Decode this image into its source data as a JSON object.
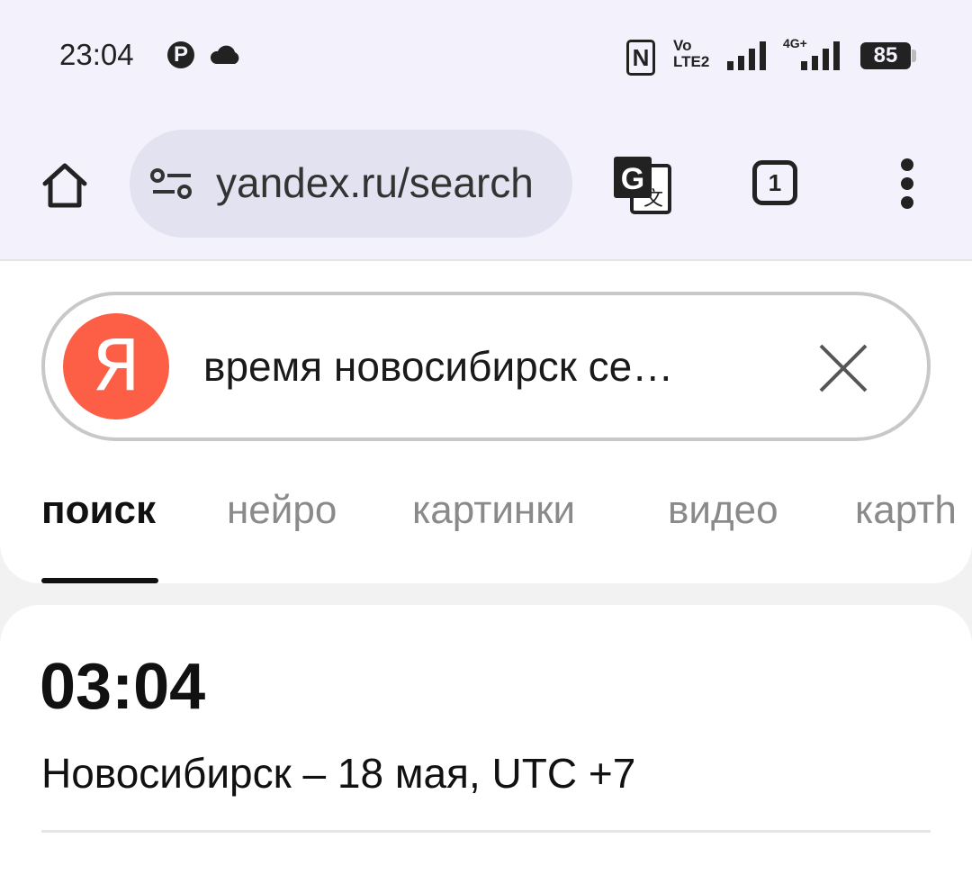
{
  "status_bar": {
    "time": "23:04",
    "pinterest_glyph": "P",
    "volte_top": "Vo",
    "volte_bottom": "LTE2",
    "network": "4G+",
    "battery": "85"
  },
  "browser": {
    "url": "yandex.ru/search",
    "tab_count": "1",
    "icons": [
      "home-icon",
      "site-settings-icon",
      "translate-icon",
      "tabs-icon",
      "more-menu-icon"
    ]
  },
  "search": {
    "logo_letter": "Я",
    "query": "время новосибирск се…",
    "tabs": [
      {
        "label": "поиск",
        "active": true
      },
      {
        "label": "нейро",
        "active": false
      },
      {
        "label": "картинки",
        "active": false
      },
      {
        "label": "видео",
        "active": false
      },
      {
        "label": "картh",
        "active": false
      }
    ]
  },
  "result": {
    "time": "03:04",
    "subtitle": "Новосибирск – 18 мая, UTC +7"
  },
  "colors": {
    "yandex_red": "#fc5f45",
    "toolbar_bg": "#f3f1fb",
    "urlbar_bg": "#e3e2f1"
  }
}
